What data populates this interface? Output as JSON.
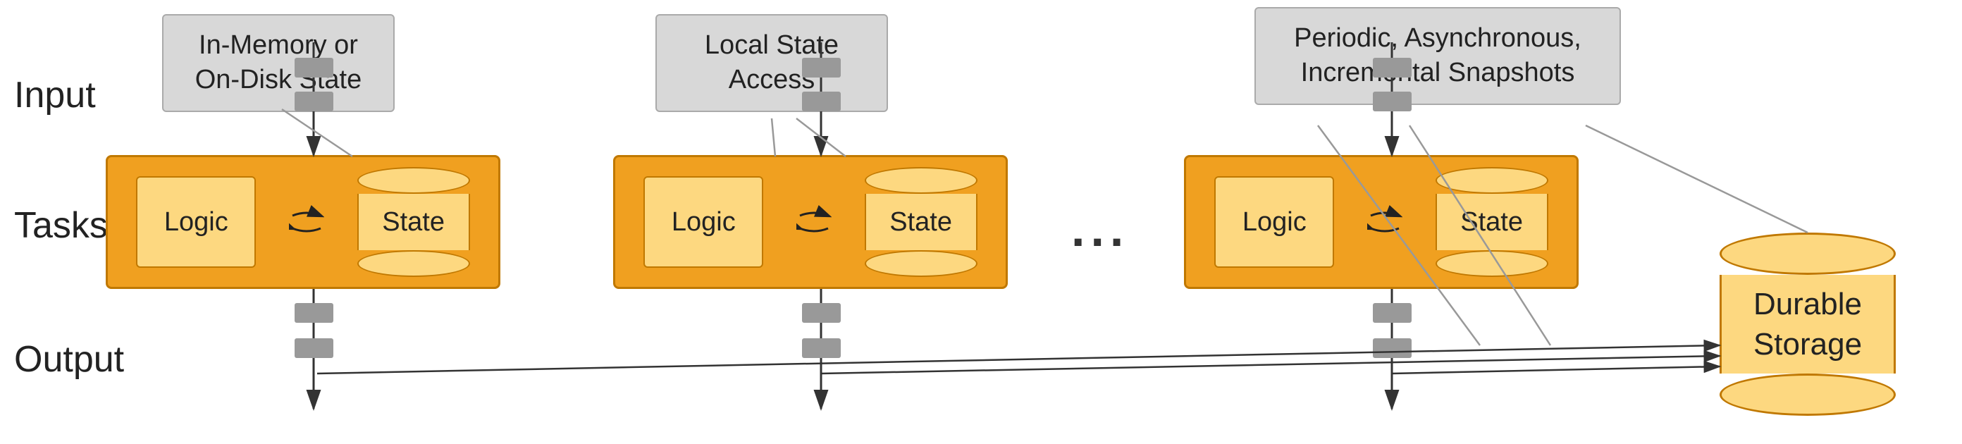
{
  "labels": {
    "input": "Input",
    "tasks": "Tasks",
    "output": "Output"
  },
  "callouts": {
    "callout1": {
      "line1": "In-Memory or",
      "line2": "On-Disk State"
    },
    "callout2": {
      "line1": "Local State",
      "line2": "Access"
    },
    "callout3": {
      "line1": "Periodic, Asynchronous,",
      "line2": "Incremental Snapshots"
    }
  },
  "tasks": [
    {
      "logic": "Logic",
      "state": "State"
    },
    {
      "logic": "Logic",
      "state": "State"
    },
    {
      "logic": "Logic",
      "state": "State"
    }
  ],
  "dots": "...",
  "durable_storage": {
    "label_line1": "Durable",
    "label_line2": "Storage"
  }
}
